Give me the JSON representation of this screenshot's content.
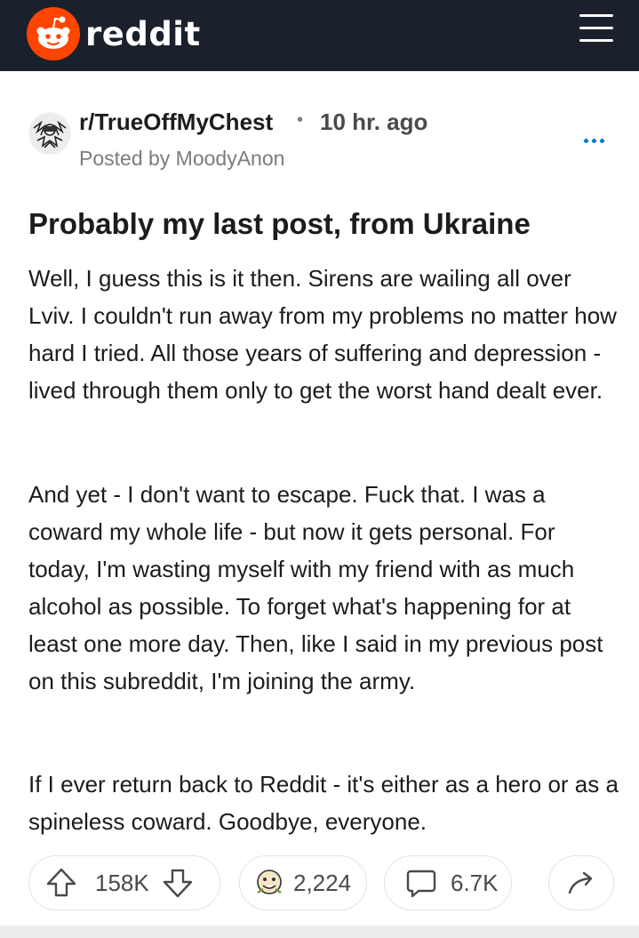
{
  "header": {
    "brand": "reddit",
    "brand_color": "#ff4500",
    "bar_color": "#1a202c",
    "menu_icon": "hamburger-menu-icon"
  },
  "post": {
    "subreddit": "r/TrueOffMyChest",
    "time_ago": "10 hr. ago",
    "posted_by": "Posted by MoodyAnon",
    "more_icon": "more-options-icon",
    "title": "Probably my last post, from Ukraine",
    "paragraphs": [
      "Well, I guess this is it then. Sirens are wailing all over Lviv. I couldn't run away from my problems no matter how hard I tried. All those years of suffering and depression - lived through them only to get the worst hand dealt ever.",
      "And yet - I don't want to escape. Fuck that. I was a coward my whole life - but now it gets personal. For today, I'm wasting myself with my friend with as much alcohol as possible. To forget what's happening for at least one more day. Then, like I said in my previous post on this subreddit, I'm joining the army.",
      "If I ever return back to Reddit - it's either as a hero or as a spineless coward. Goodbye, everyone."
    ]
  },
  "actions": {
    "upvote_icon": "upvote-arrow-icon",
    "vote_count": "158K",
    "downvote_icon": "downvote-arrow-icon",
    "award_icon": "award-icon",
    "award_count": "2,224",
    "comment_icon": "comment-bubble-icon",
    "comment_count": "6.7K",
    "share_icon": "share-arrow-icon"
  }
}
